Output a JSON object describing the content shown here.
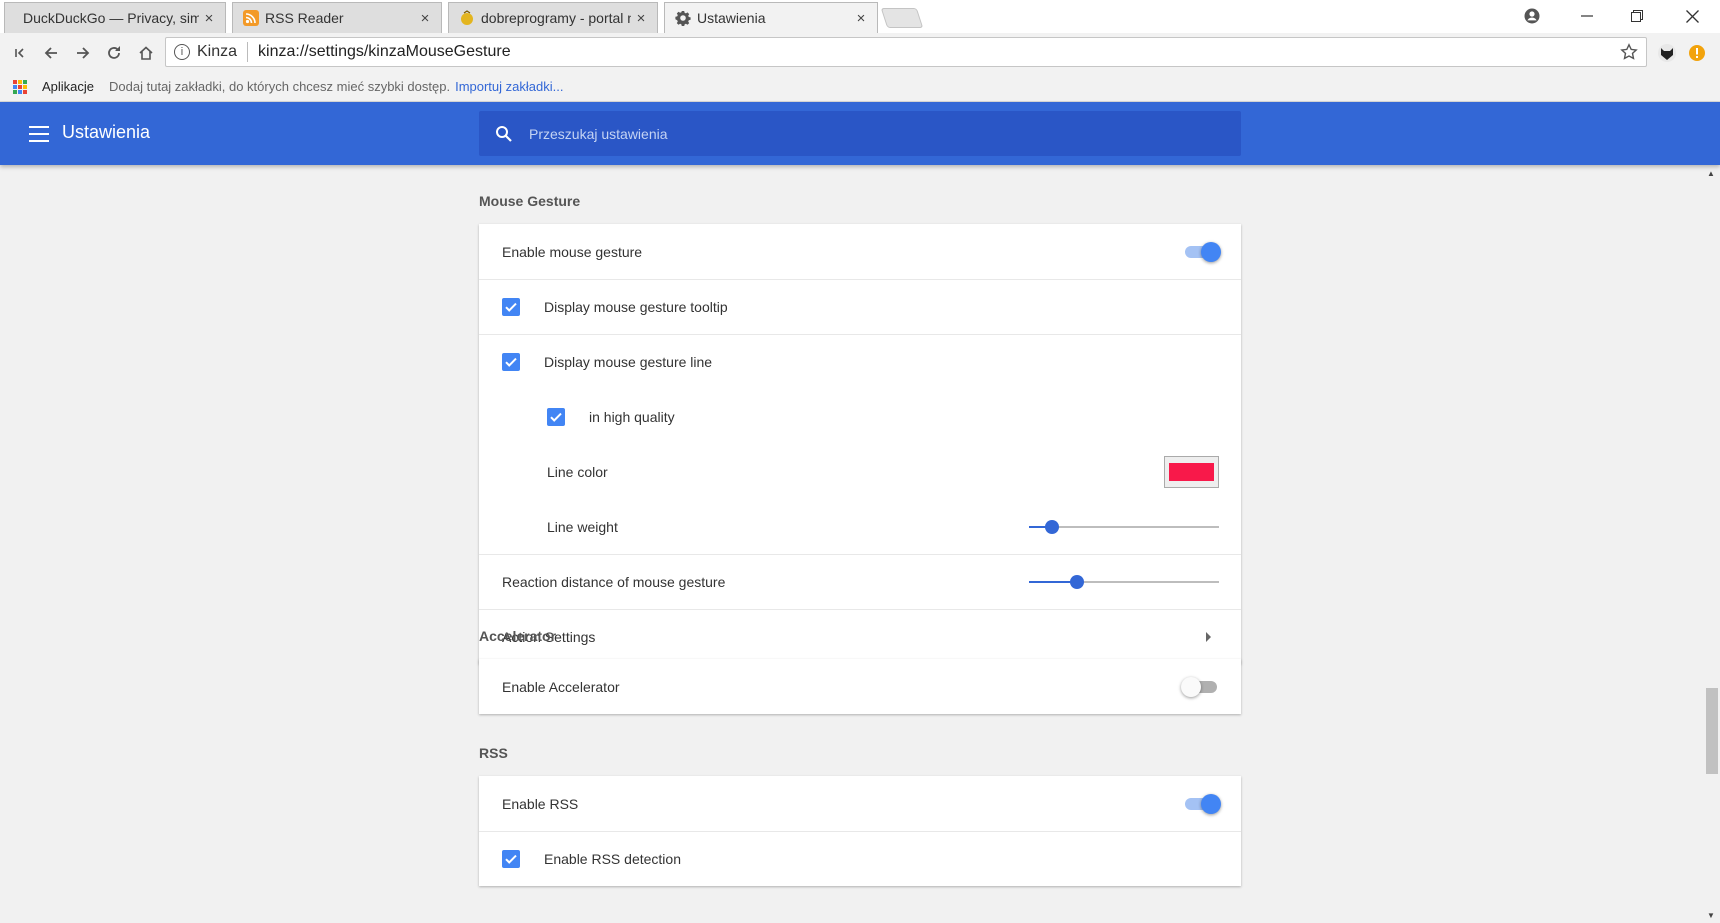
{
  "browser": {
    "tabs": [
      {
        "title": "DuckDuckGo — Privacy, simp",
        "close": "×"
      },
      {
        "title": "RSS Reader",
        "close": "×"
      },
      {
        "title": "dobreprogramy - portal n",
        "close": "×"
      },
      {
        "title": "Ustawienia",
        "close": "×"
      }
    ],
    "omnibox": {
      "site_label": "Kinza",
      "url": "kinza://settings/kinzaMouseGesture"
    },
    "bookmarks": {
      "apps_label": "Aplikacje",
      "hint": "Dodaj tutaj zakładki, do których chcesz mieć szybki dostęp.",
      "import_link": "Importuj zakładki..."
    }
  },
  "settings": {
    "title": "Ustawienia",
    "search_placeholder": "Przeszukaj ustawienia"
  },
  "mouse_gesture": {
    "heading": "Mouse Gesture",
    "enable_label": "Enable mouse gesture",
    "enable_on": true,
    "tooltip_label": "Display mouse gesture tooltip",
    "tooltip_checked": true,
    "line_label": "Display mouse gesture line",
    "line_checked": true,
    "high_quality_label": "in high quality",
    "high_quality_checked": true,
    "line_color_label": "Line color",
    "line_color": "#f8194a",
    "line_weight_label": "Line weight",
    "line_weight_fraction": 0.12,
    "reaction_label": "Reaction distance of mouse gesture",
    "reaction_fraction": 0.25,
    "action_settings_label": "Action Settings"
  },
  "accelerator": {
    "heading": "Accelerator",
    "enable_label": "Enable Accelerator",
    "enable_on": false
  },
  "rss": {
    "heading": "RSS",
    "enable_label": "Enable RSS",
    "enable_on": true,
    "detection_label": "Enable RSS detection",
    "detection_checked": true
  },
  "colors": {
    "header_blue": "#3367d6",
    "search_blue": "#2a56c6",
    "accent": "#4285f4",
    "link": "#3367d6"
  }
}
